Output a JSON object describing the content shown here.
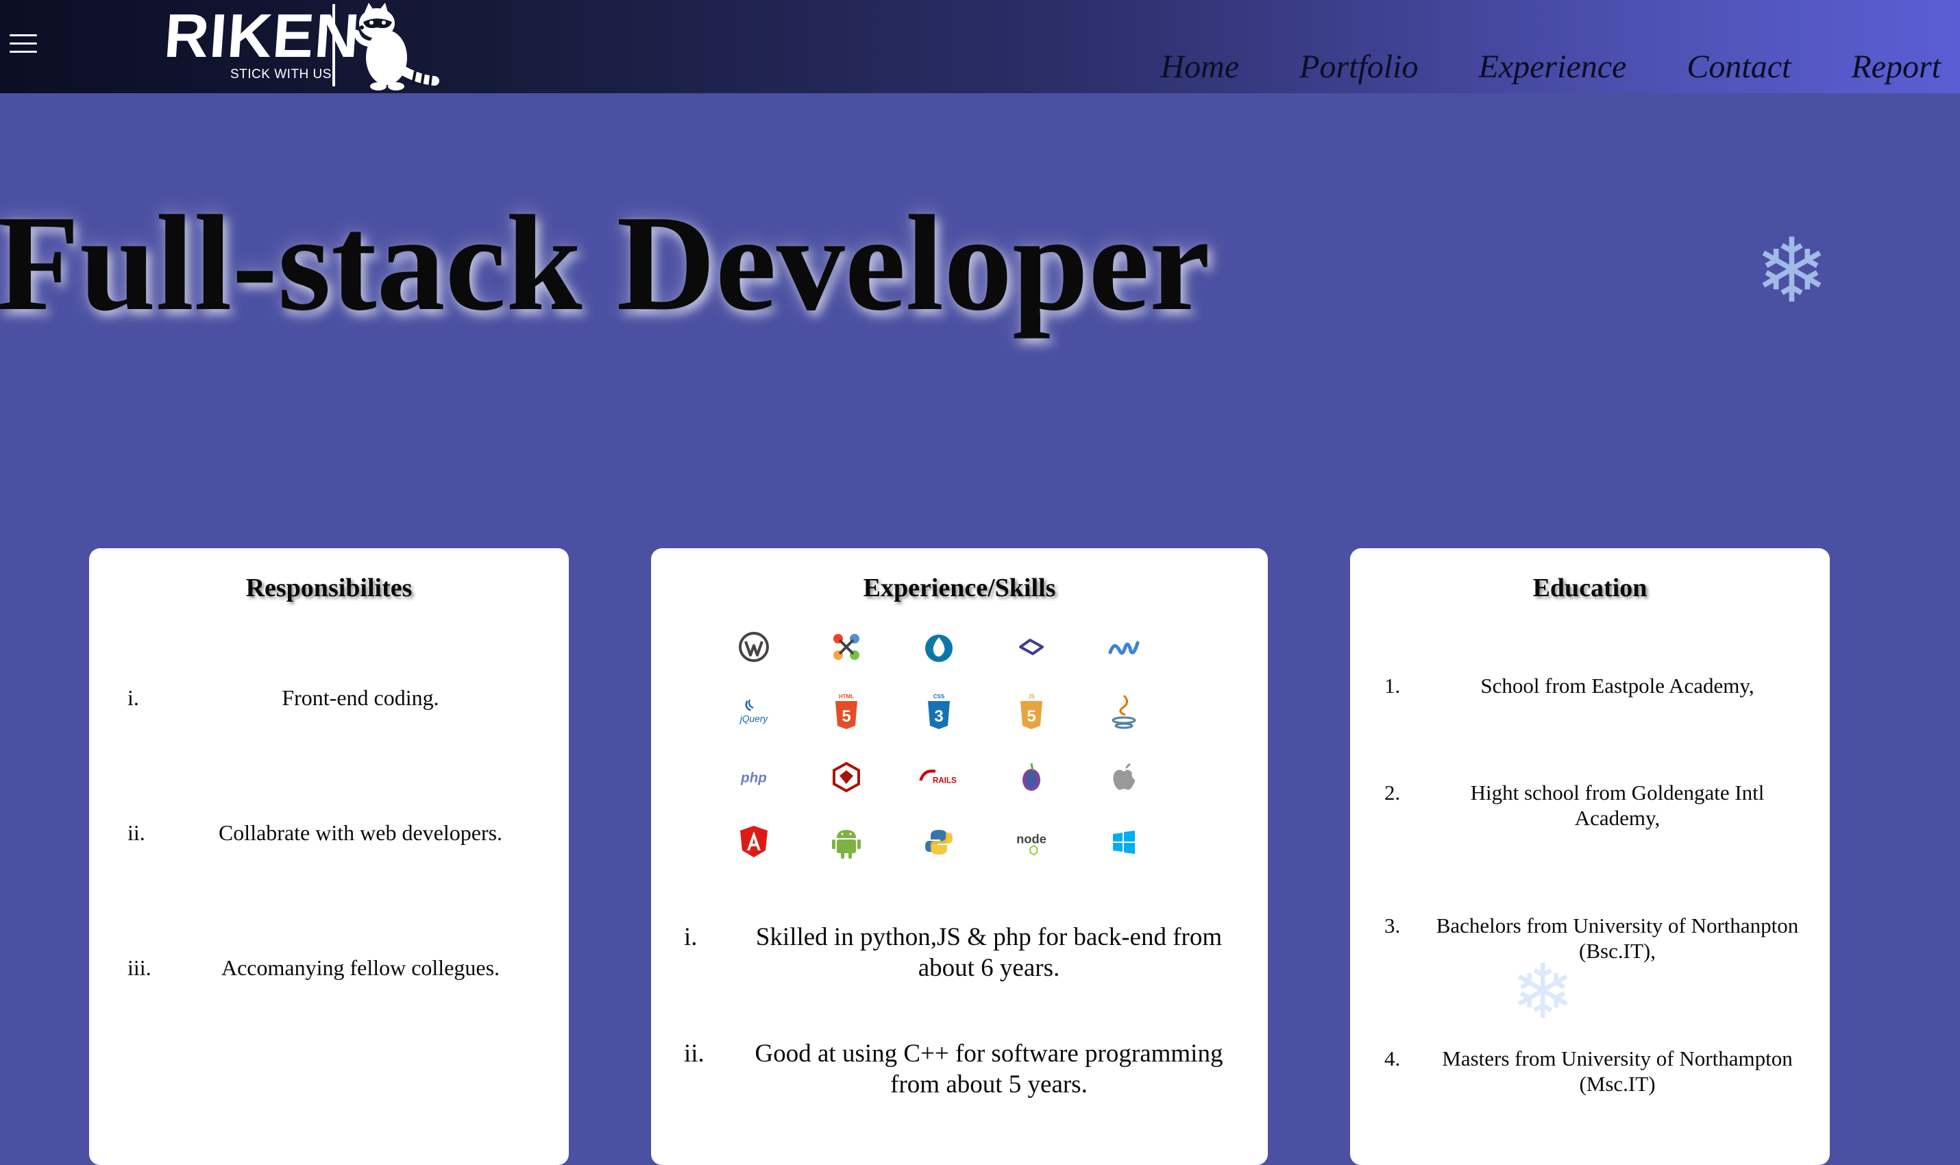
{
  "header": {
    "logo_text": "RIKEN",
    "logo_tagline": "STICK WITH US",
    "nav": [
      "Home",
      "Portfolio",
      "Experience",
      "Contact",
      "Report"
    ]
  },
  "hero": {
    "title": "Full-stack Developer"
  },
  "decor": {
    "snowflake": "❄"
  },
  "responsibilities": {
    "title": "Responsibilites",
    "items": [
      {
        "num": "i.",
        "text": "Front-end coding."
      },
      {
        "num": "ii.",
        "text": "Collabrate with web developers."
      },
      {
        "num": "iii.",
        "text": "Accomanying fellow collegues."
      }
    ]
  },
  "skills": {
    "title": "Experience/Skills",
    "icons": [
      "wordpress-icon",
      "joomla-icon",
      "drupal-icon",
      "zend-icon",
      "dotnet-icon",
      "jquery-icon",
      "html5-icon",
      "css3-icon",
      "javascript-icon",
      "java-icon",
      "php-icon",
      "ruby-icon",
      "rails-icon",
      "tor-icon",
      "apple-icon",
      "angular-icon",
      "android-icon",
      "python-icon",
      "node-icon",
      "windows-icon"
    ],
    "icon_labels": {
      "jquery": "jQuery",
      "html": "HTML",
      "css": "CSS",
      "js": "JS",
      "php": "php",
      "rails": "RAILS",
      "node": "node"
    },
    "items": [
      {
        "num": "i.",
        "text": "Skilled in python,JS & php for back-end from about 6 years."
      },
      {
        "num": "ii.",
        "text": "Good at using C++ for software programming from about 5 years."
      }
    ]
  },
  "education": {
    "title": "Education",
    "items": [
      {
        "num": "1.",
        "text": "School from Eastpole Academy,"
      },
      {
        "num": "2.",
        "text": "Hight school from Goldengate Intl Academy,"
      },
      {
        "num": "3.",
        "text": "Bachelors from University of Northanpton (Bsc.IT),"
      },
      {
        "num": "4.",
        "text": "Masters from University of Northampton (Msc.IT)"
      }
    ]
  },
  "colors": {
    "page_bg": "#4c50a2",
    "header_dark": "#0b0e24",
    "header_light": "#5a5ed4",
    "card_bg": "#ffffff"
  }
}
